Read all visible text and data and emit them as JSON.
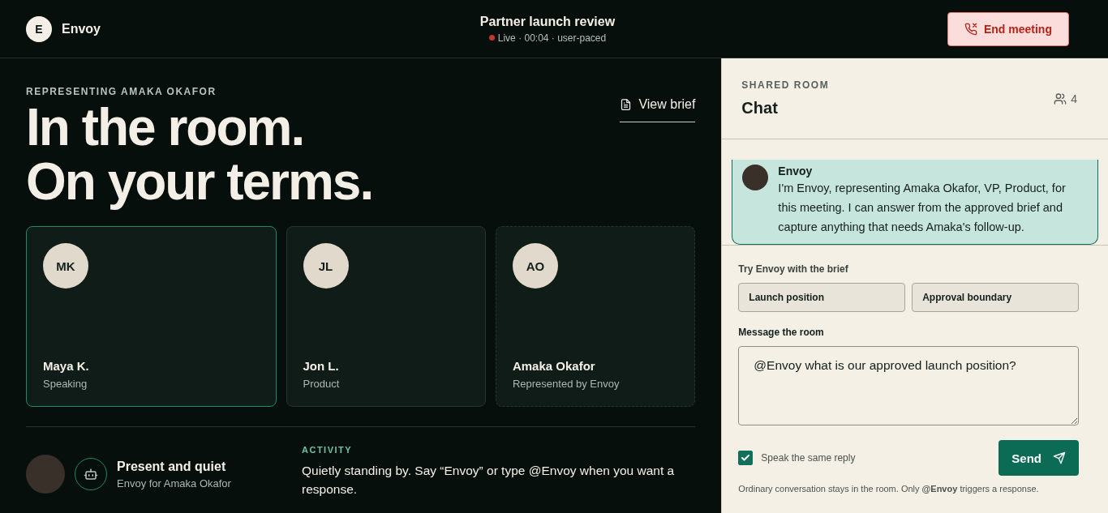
{
  "header": {
    "brand": {
      "initial": "E",
      "name": "Envoy"
    },
    "meeting": {
      "title": "Partner launch review",
      "status": "Live · 00:04 · user-paced",
      "live": true
    },
    "end_button": "End meeting"
  },
  "hero": {
    "eyebrow": "REPRESENTING AMAKA OKAFOR",
    "title_lines": [
      "In the room.",
      "On your terms."
    ],
    "view_brief": "View brief"
  },
  "participants": [
    {
      "initials": "MK",
      "name": "Maya K.",
      "role": "Speaking",
      "speaking": true,
      "represented": false
    },
    {
      "initials": "JL",
      "name": "Jon L.",
      "role": "Product",
      "speaking": false,
      "represented": false
    },
    {
      "initials": "AO",
      "name": "Amaka Okafor",
      "role": "Represented by Envoy",
      "speaking": false,
      "represented": true
    }
  ],
  "presence": {
    "title": "Present and quiet",
    "subtitle": "Envoy for Amaka Okafor"
  },
  "activity": {
    "label": "ACTIVITY",
    "text": "Quietly standing by. Say “Envoy” or type @Envoy when you want a response."
  },
  "chat": {
    "eyebrow": "SHARED ROOM",
    "title": "Chat",
    "member_count": "4",
    "messages": [
      {
        "sender": "Envoy",
        "text": "I'm Envoy, representing Amaka Okafor, VP, Product, for this meeting. I can answer from the approved brief and capture anything that needs Amaka's follow-up."
      }
    ],
    "prompts": {
      "label": "Try Envoy with the brief",
      "chips": [
        "Launch position",
        "Approval boundary"
      ]
    },
    "composer": {
      "label": "Message the room",
      "value": "@Envoy what is our approved launch position?"
    },
    "speak": {
      "label": "Speak the same reply",
      "checked": true
    },
    "send": "Send",
    "footnote": "Ordinary conversation stays in the room. Only **@Envoy** triggers a response."
  }
}
